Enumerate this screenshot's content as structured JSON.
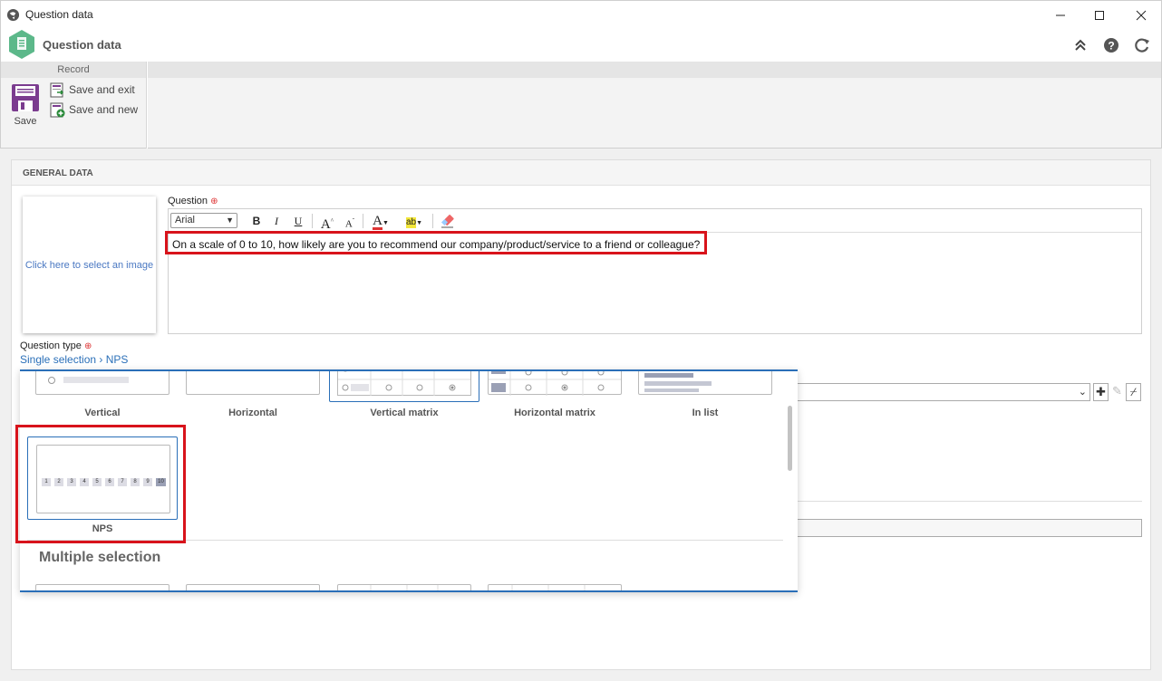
{
  "window": {
    "title": "Question data",
    "minimize_glyph": "—",
    "maximize_glyph": "☐",
    "close_glyph": "✕"
  },
  "header": {
    "title": "Question data",
    "icons": [
      "collapse-icon",
      "help-icon",
      "refresh-icon"
    ]
  },
  "ribbon": {
    "group_label": "Record",
    "save_label": "Save",
    "save_exit_label": "Save and exit",
    "save_new_label": "Save and new"
  },
  "panel": {
    "title": "GENERAL DATA",
    "image_placeholder": "Click here to select an image",
    "question_label": "Question",
    "required_mark": "⊕",
    "editor": {
      "font": "Arial",
      "bold": "B",
      "italic": "I",
      "underline": "U",
      "grow_font": "A",
      "shrink_font": "A",
      "font_color": "A",
      "highlight": "ab"
    },
    "question_text": "On a scale of 0 to 10, how likely are you to recommend our company/product/service to a friend or colleague?",
    "question_type_label": "Question type",
    "question_type_value": "Single selection › NPS"
  },
  "popup": {
    "layouts": [
      "Vertical",
      "Horizontal",
      "Vertical matrix",
      "Horizontal matrix",
      "In list"
    ],
    "nps_label": "NPS",
    "nps_scale": [
      "1",
      "2",
      "3",
      "4",
      "5",
      "6",
      "7",
      "8",
      "9",
      "10"
    ],
    "next_section": "Multiple selection"
  },
  "colors": {
    "highlight_border": "#d8131b",
    "accent": "#2a6fb8",
    "logo": "#5cb88a"
  }
}
